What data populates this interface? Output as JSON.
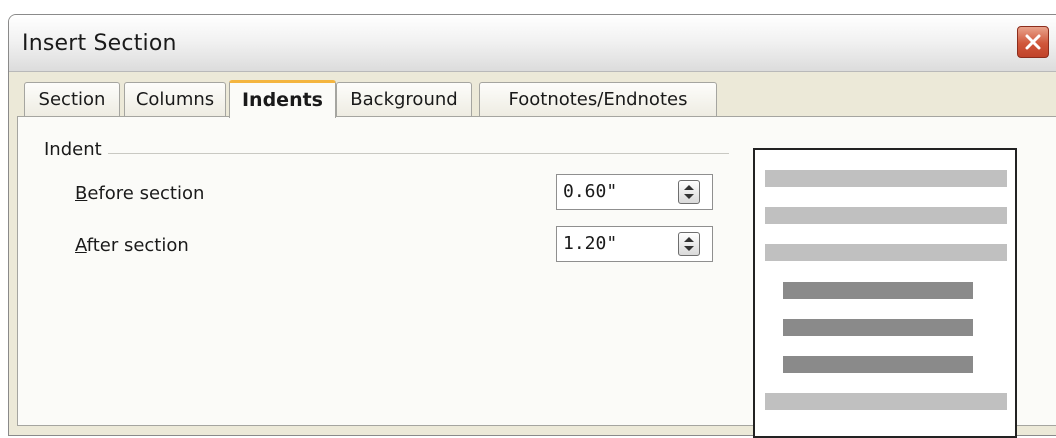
{
  "window": {
    "title": "Insert Section",
    "close_icon": "close-icon"
  },
  "tabs": [
    {
      "label": "Section",
      "active": false
    },
    {
      "label": "Columns",
      "active": false
    },
    {
      "label": "Indents",
      "active": true
    },
    {
      "label": "Background",
      "active": false
    },
    {
      "label": "Footnotes/Endnotes",
      "active": false
    }
  ],
  "indent_group": {
    "label": "Indent",
    "before": {
      "mnemonic": "B",
      "label_rest": "efore section",
      "value": "0.60\""
    },
    "after": {
      "mnemonic": "A",
      "label_rest": "fter section",
      "value": "1.20\""
    }
  },
  "preview": {
    "lines": [
      "full",
      "full",
      "full",
      "indented",
      "indented",
      "indented",
      "full"
    ]
  },
  "colors": {
    "dialog_bg": "#ece9d8",
    "active_tab_accent": "#f4b53f",
    "close_button": "#d0573a"
  }
}
